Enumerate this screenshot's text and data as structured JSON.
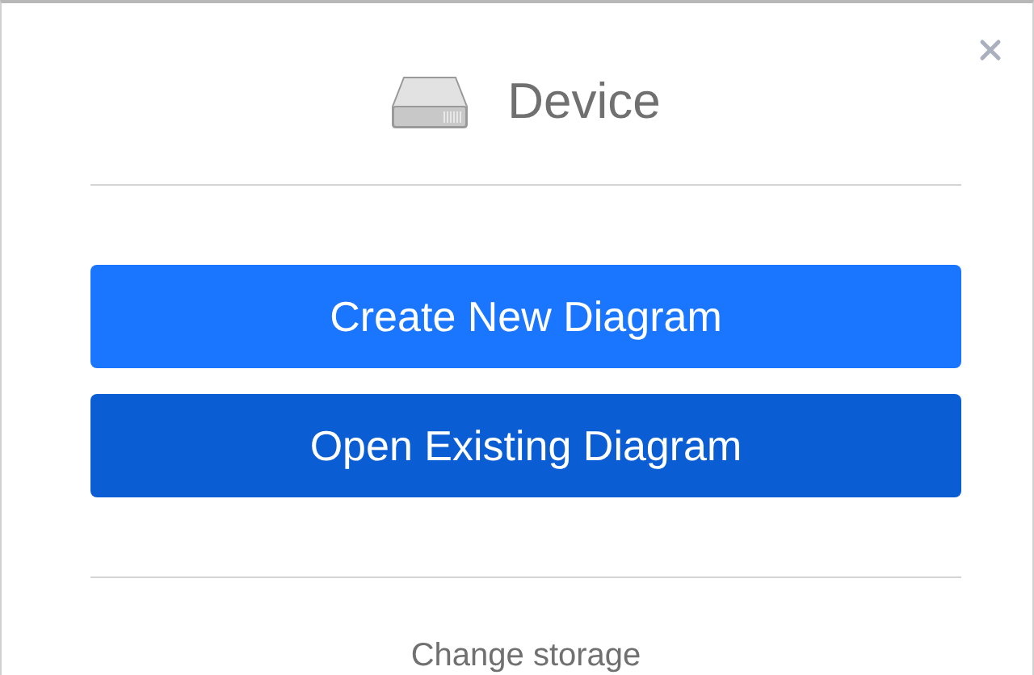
{
  "dialog": {
    "title": "Device",
    "buttons": [
      {
        "label": "Create New Diagram",
        "hovered": false
      },
      {
        "label": "Open Existing Diagram",
        "hovered": true
      }
    ],
    "footer_link": "Change storage"
  }
}
